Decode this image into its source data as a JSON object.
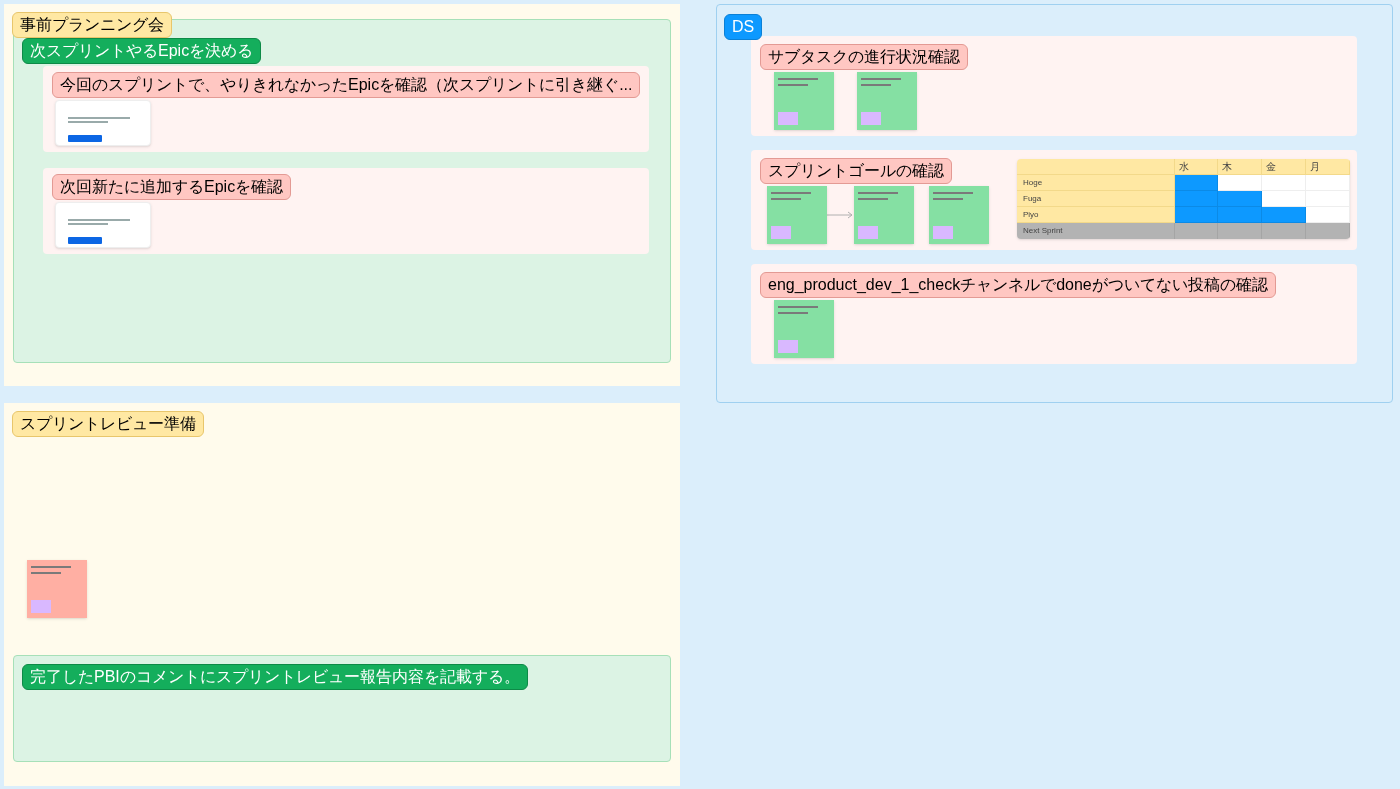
{
  "left_frames": [
    {
      "title": "事前プランニング会",
      "section": {
        "title": "次スプリントやるEpicを決める",
        "cards": [
          {
            "title": "今回のスプリントで、やりきれなかったEpicを確認（次スプリントに引き継ぐ..."
          },
          {
            "title": "次回新たに追加するEpicを確認"
          }
        ]
      }
    },
    {
      "title": "スプリントレビュー準備",
      "stickies": [
        {
          "color": "#ffafa3"
        }
      ],
      "section": {
        "title": "完了したPBIのコメントにスプリントレビュー報告内容を記載する。"
      }
    }
  ],
  "ds": {
    "title": "DS",
    "cards": [
      {
        "title": "サブタスクの進行状況確認",
        "stickies": [
          {
            "color": "#85e0a3"
          },
          {
            "color": "#85e0a3"
          }
        ]
      },
      {
        "title": "スプリントゴールの確認",
        "stickies": [
          {
            "color": "#85e0a3"
          },
          {
            "color": "#85e0a3"
          },
          {
            "color": "#85e0a3"
          }
        ],
        "arrow": true,
        "table": {
          "columns": [
            "水",
            "木",
            "金",
            "月"
          ],
          "rows": [
            {
              "label": "Hoge",
              "cells": [
                {
                  "filled": true
                },
                {
                  "filled": false
                },
                {
                  "filled": false
                },
                {
                  "filled": false
                }
              ]
            },
            {
              "label": "Fuga",
              "cells": [
                {
                  "filled": true
                },
                {
                  "filled": true
                },
                {
                  "filled": false
                },
                {
                  "filled": false
                }
              ]
            },
            {
              "label": "Piyo",
              "cells": [
                {
                  "filled": true
                },
                {
                  "filled": true
                },
                {
                  "filled": true
                },
                {
                  "filled": false
                }
              ]
            }
          ],
          "footer": "Next Sprint"
        }
      },
      {
        "title": "eng_product_dev_1_checkチャンネルでdoneがついてない投稿の確認",
        "stickies": [
          {
            "color": "#85e0a3"
          }
        ]
      }
    ]
  }
}
